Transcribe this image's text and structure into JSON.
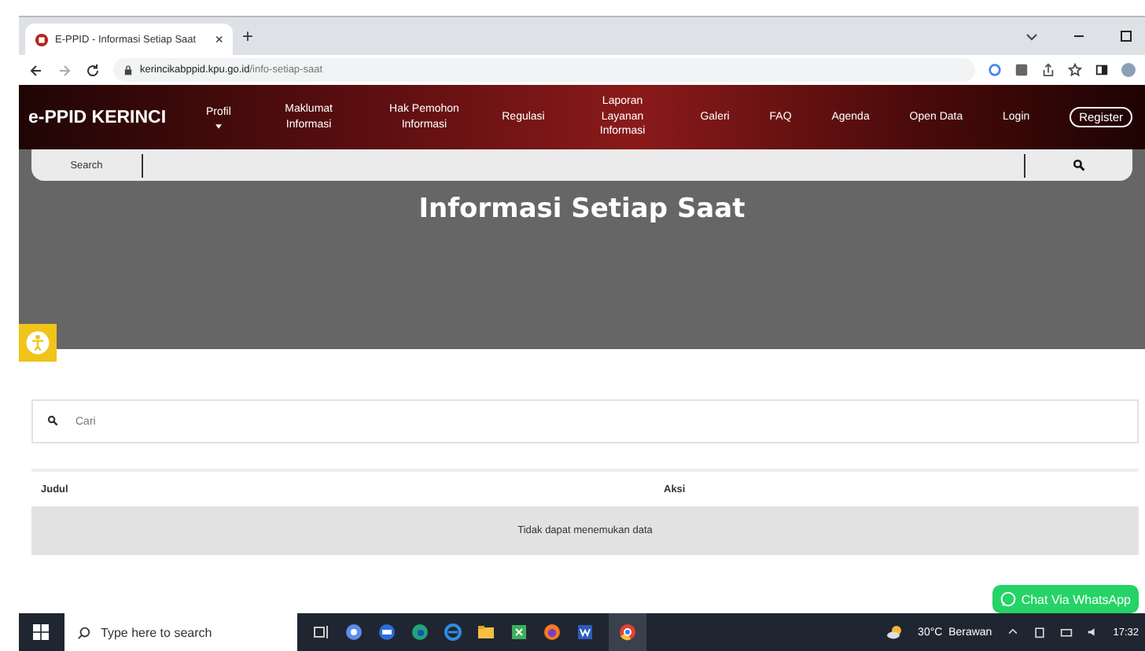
{
  "browser": {
    "tab_title": "E-PPID - Informasi Setiap Saat",
    "tab_close": "×",
    "new_tab": "+",
    "url_host": "kerincikabppid.kpu.go.id",
    "url_path": "/info-setiap-saat"
  },
  "nav": {
    "brand": "e-PPID KERINCI",
    "items": [
      {
        "label": "Profil",
        "dropdown": true
      },
      {
        "label": "Maklumat Informasi",
        "dropdown": false
      },
      {
        "label": "Hak Pemohon Informasi",
        "dropdown": false
      },
      {
        "label": "Regulasi",
        "dropdown": false
      },
      {
        "label": "Laporan Layanan Informasi",
        "dropdown": false
      },
      {
        "label": "Galeri",
        "dropdown": false
      },
      {
        "label": "FAQ",
        "dropdown": false
      },
      {
        "label": "Agenda",
        "dropdown": false
      },
      {
        "label": "Open Data",
        "dropdown": false
      },
      {
        "label": "Login",
        "dropdown": false
      }
    ],
    "register": "Register"
  },
  "search_bar": {
    "label": "Search"
  },
  "hero": {
    "title": "Informasi Setiap Saat"
  },
  "filter": {
    "placeholder": "Cari"
  },
  "table": {
    "columns": [
      "Judul",
      "Aksi"
    ],
    "empty_message": "Tidak dapat menemukan data"
  },
  "whatsapp": {
    "label": "Chat Via WhatsApp"
  },
  "taskbar": {
    "search_placeholder": "Type here to search",
    "weather": "30°C  Berawan",
    "time": "17:32"
  }
}
